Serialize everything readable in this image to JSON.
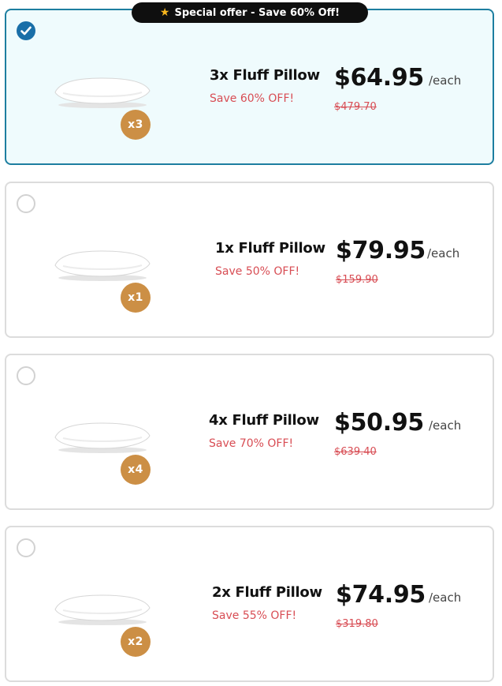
{
  "banner": {
    "icon": "star-icon",
    "text": "Special offer - Save 60% Off!"
  },
  "colors": {
    "selected_border": "#1d7ea0",
    "selected_background": "#effbfd",
    "radio_checked": "#1a6fa8",
    "save_text": "#d84d54",
    "quantity_badge": "#cc8f45"
  },
  "per_unit_suffix": "/each",
  "offers": [
    {
      "selected": true,
      "quantity_badge": "x3",
      "name": "3x Fluff Pillow",
      "save_text": "Save 60% OFF!",
      "price": "$64.95",
      "original_price": "$479.70"
    },
    {
      "selected": false,
      "quantity_badge": "x1",
      "name": "1x Fluff Pillow",
      "save_text": "Save 50% OFF!",
      "price": "$79.95",
      "original_price": "$159.90"
    },
    {
      "selected": false,
      "quantity_badge": "x4",
      "name": "4x Fluff Pillow",
      "save_text": "Save 70% OFF!",
      "price": "$50.95",
      "original_price": "$639.40"
    },
    {
      "selected": false,
      "quantity_badge": "x2",
      "name": "2x Fluff Pillow",
      "save_text": "Save 55% OFF!",
      "price": "$74.95",
      "original_price": "$319.80"
    }
  ]
}
